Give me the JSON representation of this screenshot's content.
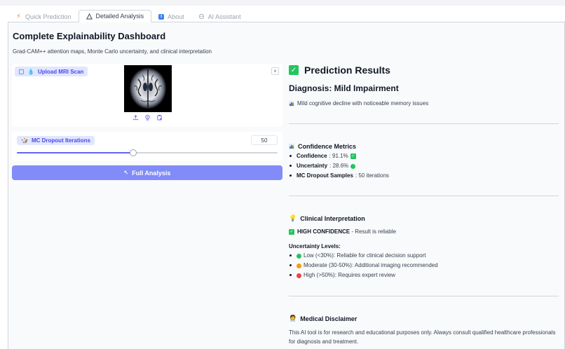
{
  "tabs": [
    {
      "label": "Quick Prediction",
      "icon": "bolt-icon",
      "active": false
    },
    {
      "label": "Detailed Analysis",
      "icon": "triangle-icon",
      "active": true
    },
    {
      "label": "About",
      "icon": "info-icon",
      "active": false
    },
    {
      "label": "AI Assistant",
      "icon": "bot-icon",
      "active": false
    }
  ],
  "header": {
    "title": "Complete Explainability Dashboard",
    "subtitle": "Grad-CAM++ attention maps, Monte Carlo uncertainty, and clinical interpretation"
  },
  "upload": {
    "label": "Upload MRI Scan",
    "close": "×"
  },
  "slider": {
    "label": "MC Dropout Iterations",
    "value": "50",
    "fraction": 0.445
  },
  "analyze_button": "Full Analysis",
  "results": {
    "title": "Prediction Results",
    "diagnosis": "Diagnosis: Mild Impairment",
    "description": "Mild cognitive decline with noticeable memory issues",
    "metrics_title": "Confidence Metrics",
    "metrics": [
      {
        "key": "Confidence",
        "value": ": 91.1%"
      },
      {
        "key": "Uncertainty",
        "value": ": 28.6%"
      },
      {
        "key": "MC Dropout Samples",
        "value": ": 50 iterations"
      }
    ],
    "clinical_title": "Clinical Interpretation",
    "high_conf_key": "HIGH CONFIDENCE",
    "high_conf_text": " - Result is reliable",
    "uncertainty_title": "Uncertainty Levels:",
    "levels": [
      {
        "text": "Low (<30%): Reliable for clinical decision support",
        "color": "#22c55e"
      },
      {
        "text": "Moderate (30-50%): Additional imaging recommended",
        "color": "#f59e0b"
      },
      {
        "text": "High (>50%): Requires expert review",
        "color": "#ef4444"
      }
    ],
    "disclaimer_title": "Medical Disclaimer",
    "disclaimer_text": "This AI tool is for research and educational purposes only. Always consult qualified healthcare professionals for diagnosis and treatment."
  },
  "colors": {
    "accent": "#6366f1",
    "button": "#818cf8",
    "success": "#22c55e"
  }
}
